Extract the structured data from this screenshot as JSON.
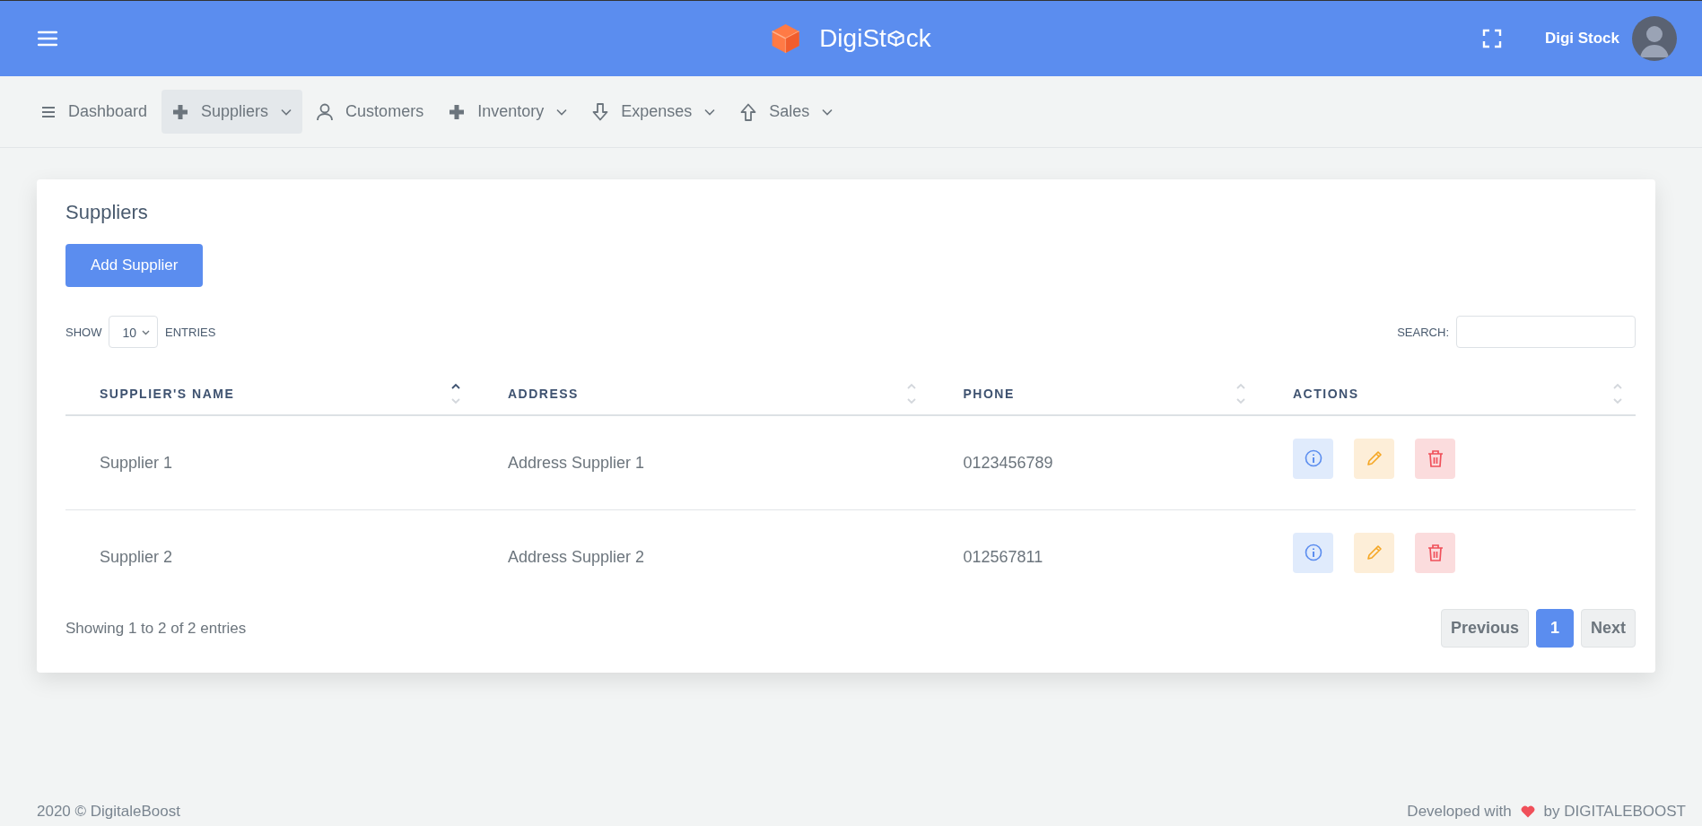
{
  "header": {
    "logo": {
      "before": "DigiSt",
      "after": "ck"
    },
    "user": {
      "name": "Digi Stock"
    }
  },
  "nav": [
    {
      "label": "Dashboard",
      "kind": "menu",
      "dropdown": false,
      "selected": false
    },
    {
      "label": "Suppliers",
      "kind": "plus",
      "dropdown": true,
      "selected": true
    },
    {
      "label": "Customers",
      "kind": "person",
      "dropdown": false,
      "selected": false
    },
    {
      "label": "Inventory",
      "kind": "plus",
      "dropdown": true,
      "selected": false
    },
    {
      "label": "Expenses",
      "kind": "down",
      "dropdown": true,
      "selected": false
    },
    {
      "label": "Sales",
      "kind": "up",
      "dropdown": true,
      "selected": false
    }
  ],
  "card": {
    "title": "Suppliers",
    "add_button": "Add Supplier",
    "length": {
      "before": "SHOW",
      "value": "10",
      "after": "ENTRIES"
    },
    "search": {
      "label": "SEARCH:"
    },
    "table": {
      "columns": [
        {
          "label": "SUPPLIER'S NAME",
          "sorted": true
        },
        {
          "label": "ADDRESS",
          "sorted": false
        },
        {
          "label": "PHONE",
          "sorted": false
        },
        {
          "label": "ACTIONS",
          "sorted": false
        }
      ],
      "rows": [
        {
          "name": "Supplier 1",
          "address": "Address Supplier 1",
          "phone": "0123456789"
        },
        {
          "name": "Supplier 2",
          "address": "Address Supplier 2",
          "phone": "012567811"
        }
      ]
    },
    "info": "Showing 1 to 2 of 2 entries",
    "pagination": [
      {
        "label": "Previous",
        "selected": false
      },
      {
        "label": "1",
        "selected": true
      },
      {
        "label": "Next",
        "selected": false
      }
    ]
  },
  "footer": {
    "copyright": "2020 © DigitaleBoost",
    "credit_before": "Developed with",
    "credit_after": "by DIGITALEBOOST"
  }
}
